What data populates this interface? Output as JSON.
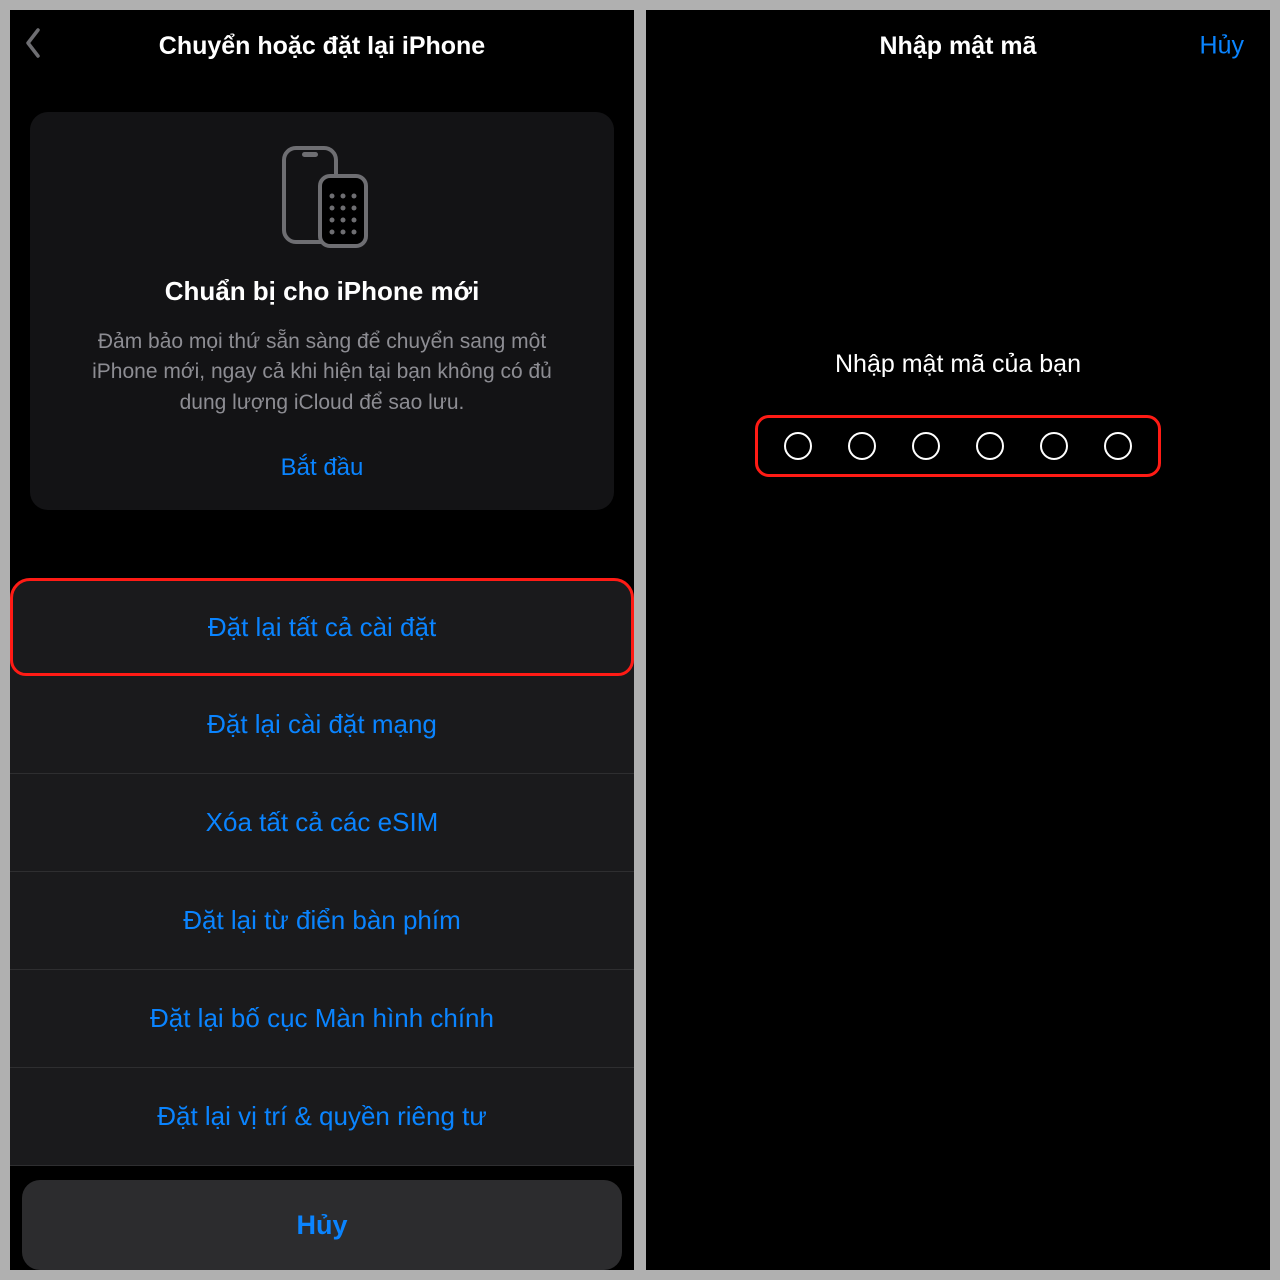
{
  "left": {
    "nav_title": "Chuyển hoặc đặt lại iPhone",
    "card": {
      "title": "Chuẩn bị cho iPhone mới",
      "desc": "Đảm bảo mọi thứ sẵn sàng để chuyển sang một iPhone mới, ngay cả khi hiện tại bạn không có đủ dung lượng iCloud để sao lưu.",
      "start": "Bắt đầu"
    },
    "sheet": {
      "options": [
        "Đặt lại tất cả cài đặt",
        "Đặt lại cài đặt mạng",
        "Xóa tất cả các eSIM",
        "Đặt lại từ điển bàn phím",
        "Đặt lại bố cục Màn hình chính",
        "Đặt lại vị trí & quyền riêng tư"
      ],
      "cancel": "Hủy"
    }
  },
  "right": {
    "nav_title": "Nhập mật mã",
    "nav_cancel": "Hủy",
    "prompt": "Nhập mật mã của bạn",
    "passcode_length": 6
  }
}
